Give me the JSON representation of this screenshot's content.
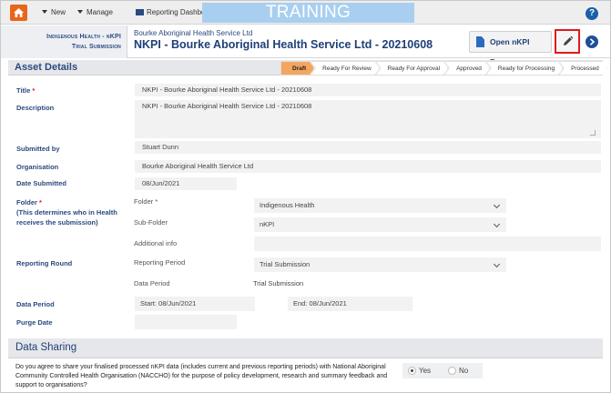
{
  "nav": {
    "new_label": "New",
    "manage_label": "Manage",
    "dashboard_label": "Reporting Dashboard",
    "banner": "TRAINING ENVIRONMENT",
    "help_icon": "?"
  },
  "header": {
    "breadcrumb_line1": "Indigenous Health - nKPI",
    "breadcrumb_line2": "Trial Submission",
    "org": "Bourke Aboriginal Health Service Ltd",
    "title": "NKPI - Bourke Aboriginal Health Service Ltd - 20210608",
    "open_button": "Open nKPI Form"
  },
  "section": {
    "asset_details": "Asset Details"
  },
  "workflow": {
    "steps": [
      "Draft",
      "Ready For Review",
      "Ready For Approval",
      "Approved",
      "Ready for Processing",
      "Processed"
    ],
    "active": "Draft"
  },
  "form": {
    "title_label": "Title",
    "title_value": "NKPI - Bourke Aboriginal Health Service Ltd - 20210608",
    "description_label": "Description",
    "description_value": "NKPI - Bourke Aboriginal Health Service Ltd - 20210608",
    "submitted_by_label": "Submitted by",
    "submitted_by_value": "Stuart Dunn",
    "organisation_label": "Organisation",
    "organisation_value": "Bourke Aboriginal Health Service Ltd",
    "date_submitted_label": "Date Submitted",
    "date_submitted_value": "08/Jun/2021",
    "folder_label": "Folder",
    "folder_note": "(This determines who in Health receives the submission)",
    "folder_sub_label": "Folder",
    "folder_value": "Indigenous Health",
    "subfolder_label": "Sub-Folder",
    "subfolder_value": "nKPI",
    "additional_info_label": "Additional info",
    "reporting_round_label": "Reporting Round",
    "reporting_period_label": "Reporting Period",
    "reporting_period_value": "Trial Submission",
    "data_period_sub_label": "Data Period",
    "data_period_sub_value": "Trial Submission",
    "data_period_label": "Data Period",
    "start_label": "Start:",
    "start_value": "08/Jun/2021",
    "end_label": "End:",
    "end_value": "08/Jun/2021",
    "purge_date_label": "Purge Date",
    "required_mark": "*"
  },
  "data_sharing": {
    "heading": "Data Sharing",
    "question": "Do you agree to share your finalised processed nKPI data (includes current and previous reporting periods) with National Aboriginal Community Controlled Health Organisation (NACCHO) for the purpose of policy development, research and summary feedback and support to organisations?",
    "yes_label": "Yes",
    "no_label": "No",
    "selected": "Yes"
  },
  "colors": {
    "brand_orange": "#e8651c",
    "navy": "#1f3f77",
    "active_step": "#f4a65f",
    "banner": "#a9cff0",
    "highlight_red": "#e01a1a"
  }
}
